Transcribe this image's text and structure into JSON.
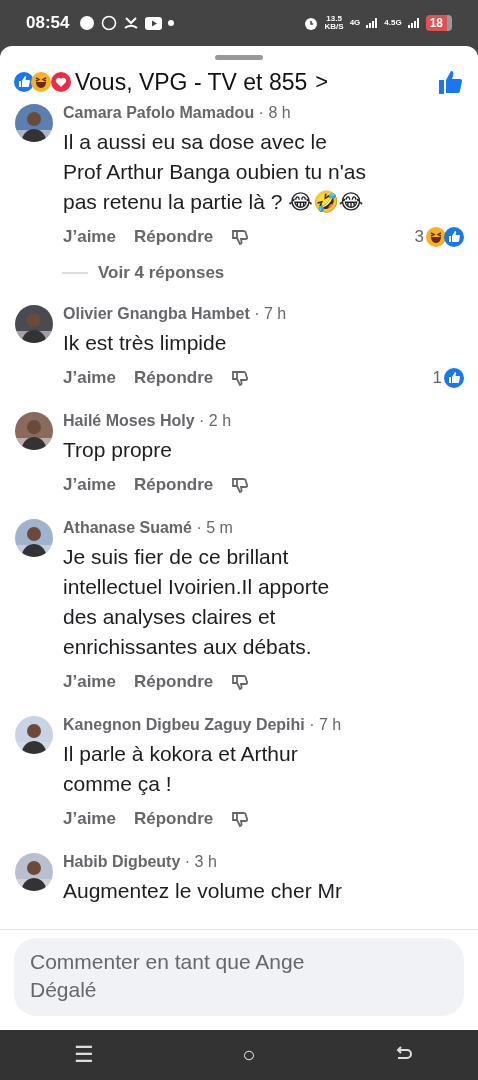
{
  "status_bar": {
    "time": "08:54",
    "speed": "13.5",
    "speed_unit": "KB/S",
    "network_1": "4G",
    "network_2": "4.5G",
    "battery": "18"
  },
  "header": {
    "title": "Vous, VPG - TV et 855",
    "chevron": ">"
  },
  "comments": [
    {
      "author": "Camara Pafolo Mamadou",
      "time": "· 8 h",
      "text": "Il a aussi eu sa dose avec le\nProf Arthur Banga oubien tu n'as\npas retenu la partie là ? 😂🤣😂",
      "like": "J’aime",
      "reply": "Répondre",
      "reaction_count": "3",
      "reactions": [
        {
          "kind": "haha"
        },
        {
          "kind": "like"
        }
      ],
      "replies_link": "Voir 4 réponses"
    },
    {
      "author": "Olivier Gnangba Hambet",
      "time": "· 7 h",
      "text": "Ik est très limpide",
      "like": "J’aime",
      "reply": "Répondre",
      "reaction_count": "1",
      "reactions": [
        {
          "kind": "like"
        }
      ]
    },
    {
      "author": "Hailé Moses Holy",
      "time": "· 2 h",
      "text": "Trop propre",
      "like": "J’aime",
      "reply": "Répondre"
    },
    {
      "author": "Athanase Suamé",
      "time": "· 5 m",
      "text": "Je suis fier de ce brillant\nintellectuel Ivoirien.Il apporte\ndes analyses claires et\nenrichissantes aux débats.",
      "like": "J’aime",
      "reply": "Répondre"
    },
    {
      "author": "Kanegnon Digbeu Zaguy Depihi",
      "time": "· 7 h",
      "text": "Il parle à kokora et Arthur\ncomme ça !",
      "like": "J’aime",
      "reply": "Répondre"
    },
    {
      "author": "Habib Digbeuty",
      "time": "· 3 h",
      "text": "Augmentez le volume cher Mr"
    }
  ],
  "composer": {
    "placeholder": "Commenter en tant que Ange Dégalé"
  },
  "nav_bar": {
    "menu": "☰",
    "home": "○"
  }
}
